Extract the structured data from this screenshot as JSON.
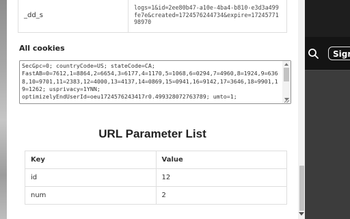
{
  "background": {
    "signin_label": "Sign"
  },
  "top_row": {
    "key": "_dd_s",
    "value": "logs=1&id=2ee80b47-a10e-4ba4-b810-e3d3a499fe7e&created=1724576244734&expire=1724577198970"
  },
  "all_cookies": {
    "heading": "All cookies",
    "text": "SecGpc=0; countryCode=US; stateCode=CA;\nFastAB=0=7612,1=8864,2=6654,3=6177,4=1170,5=1068,6=0294,7=4960,8=1924,9=6368,10=9701,11=2383,12=4000,13=4137,14=0869,15=0941,16=9142,17=3646,18=9901,19=1262; usprivacy=1YNN;\noptimizelyEndUserId=oeu1724576243417r0.499328072763789; umto=1;"
  },
  "url_params": {
    "title": "URL Parameter List",
    "headers": {
      "key": "Key",
      "value": "Value"
    },
    "rows": [
      {
        "key": "id",
        "value": "12"
      },
      {
        "key": "num",
        "value": "2"
      }
    ]
  }
}
